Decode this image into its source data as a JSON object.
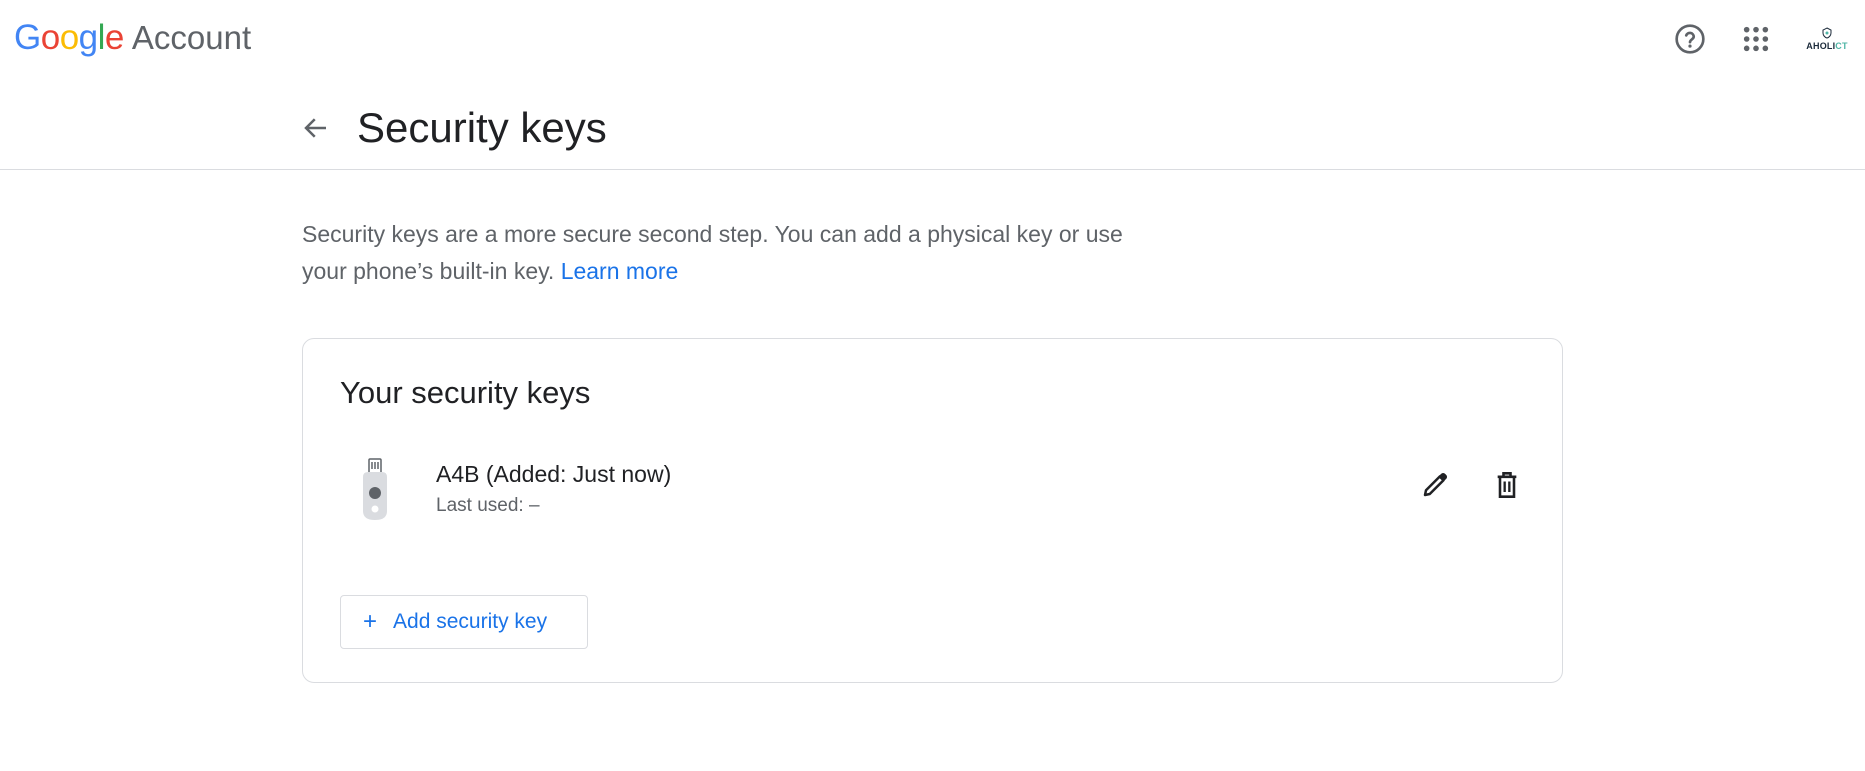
{
  "header": {
    "logo_google_letters": [
      "G",
      "o",
      "o",
      "g",
      "l",
      "e"
    ],
    "logo_product": "Account",
    "avatar_text_main": "AHOLI",
    "avatar_text_accent": "CT",
    "icons": [
      "help-circle-icon",
      "apps-grid-icon"
    ]
  },
  "page": {
    "title": "Security keys",
    "back_icon": "arrow-left-icon"
  },
  "description": {
    "text": "Security keys are a more secure second step. You can add a physical key or use your phone’s built-in key.",
    "link": "Learn more"
  },
  "card": {
    "title": "Your security keys",
    "keys": [
      {
        "name": "A4B (Added: Just now)",
        "last_used": "Last used: –",
        "icon": "usb-security-key-icon"
      }
    ],
    "add_button": {
      "icon": "+",
      "label": "Add security key"
    }
  },
  "colors": {
    "link": "#1a73e8",
    "text_primary": "#202124",
    "text_secondary": "#5f6368",
    "border": "#dadce0"
  }
}
